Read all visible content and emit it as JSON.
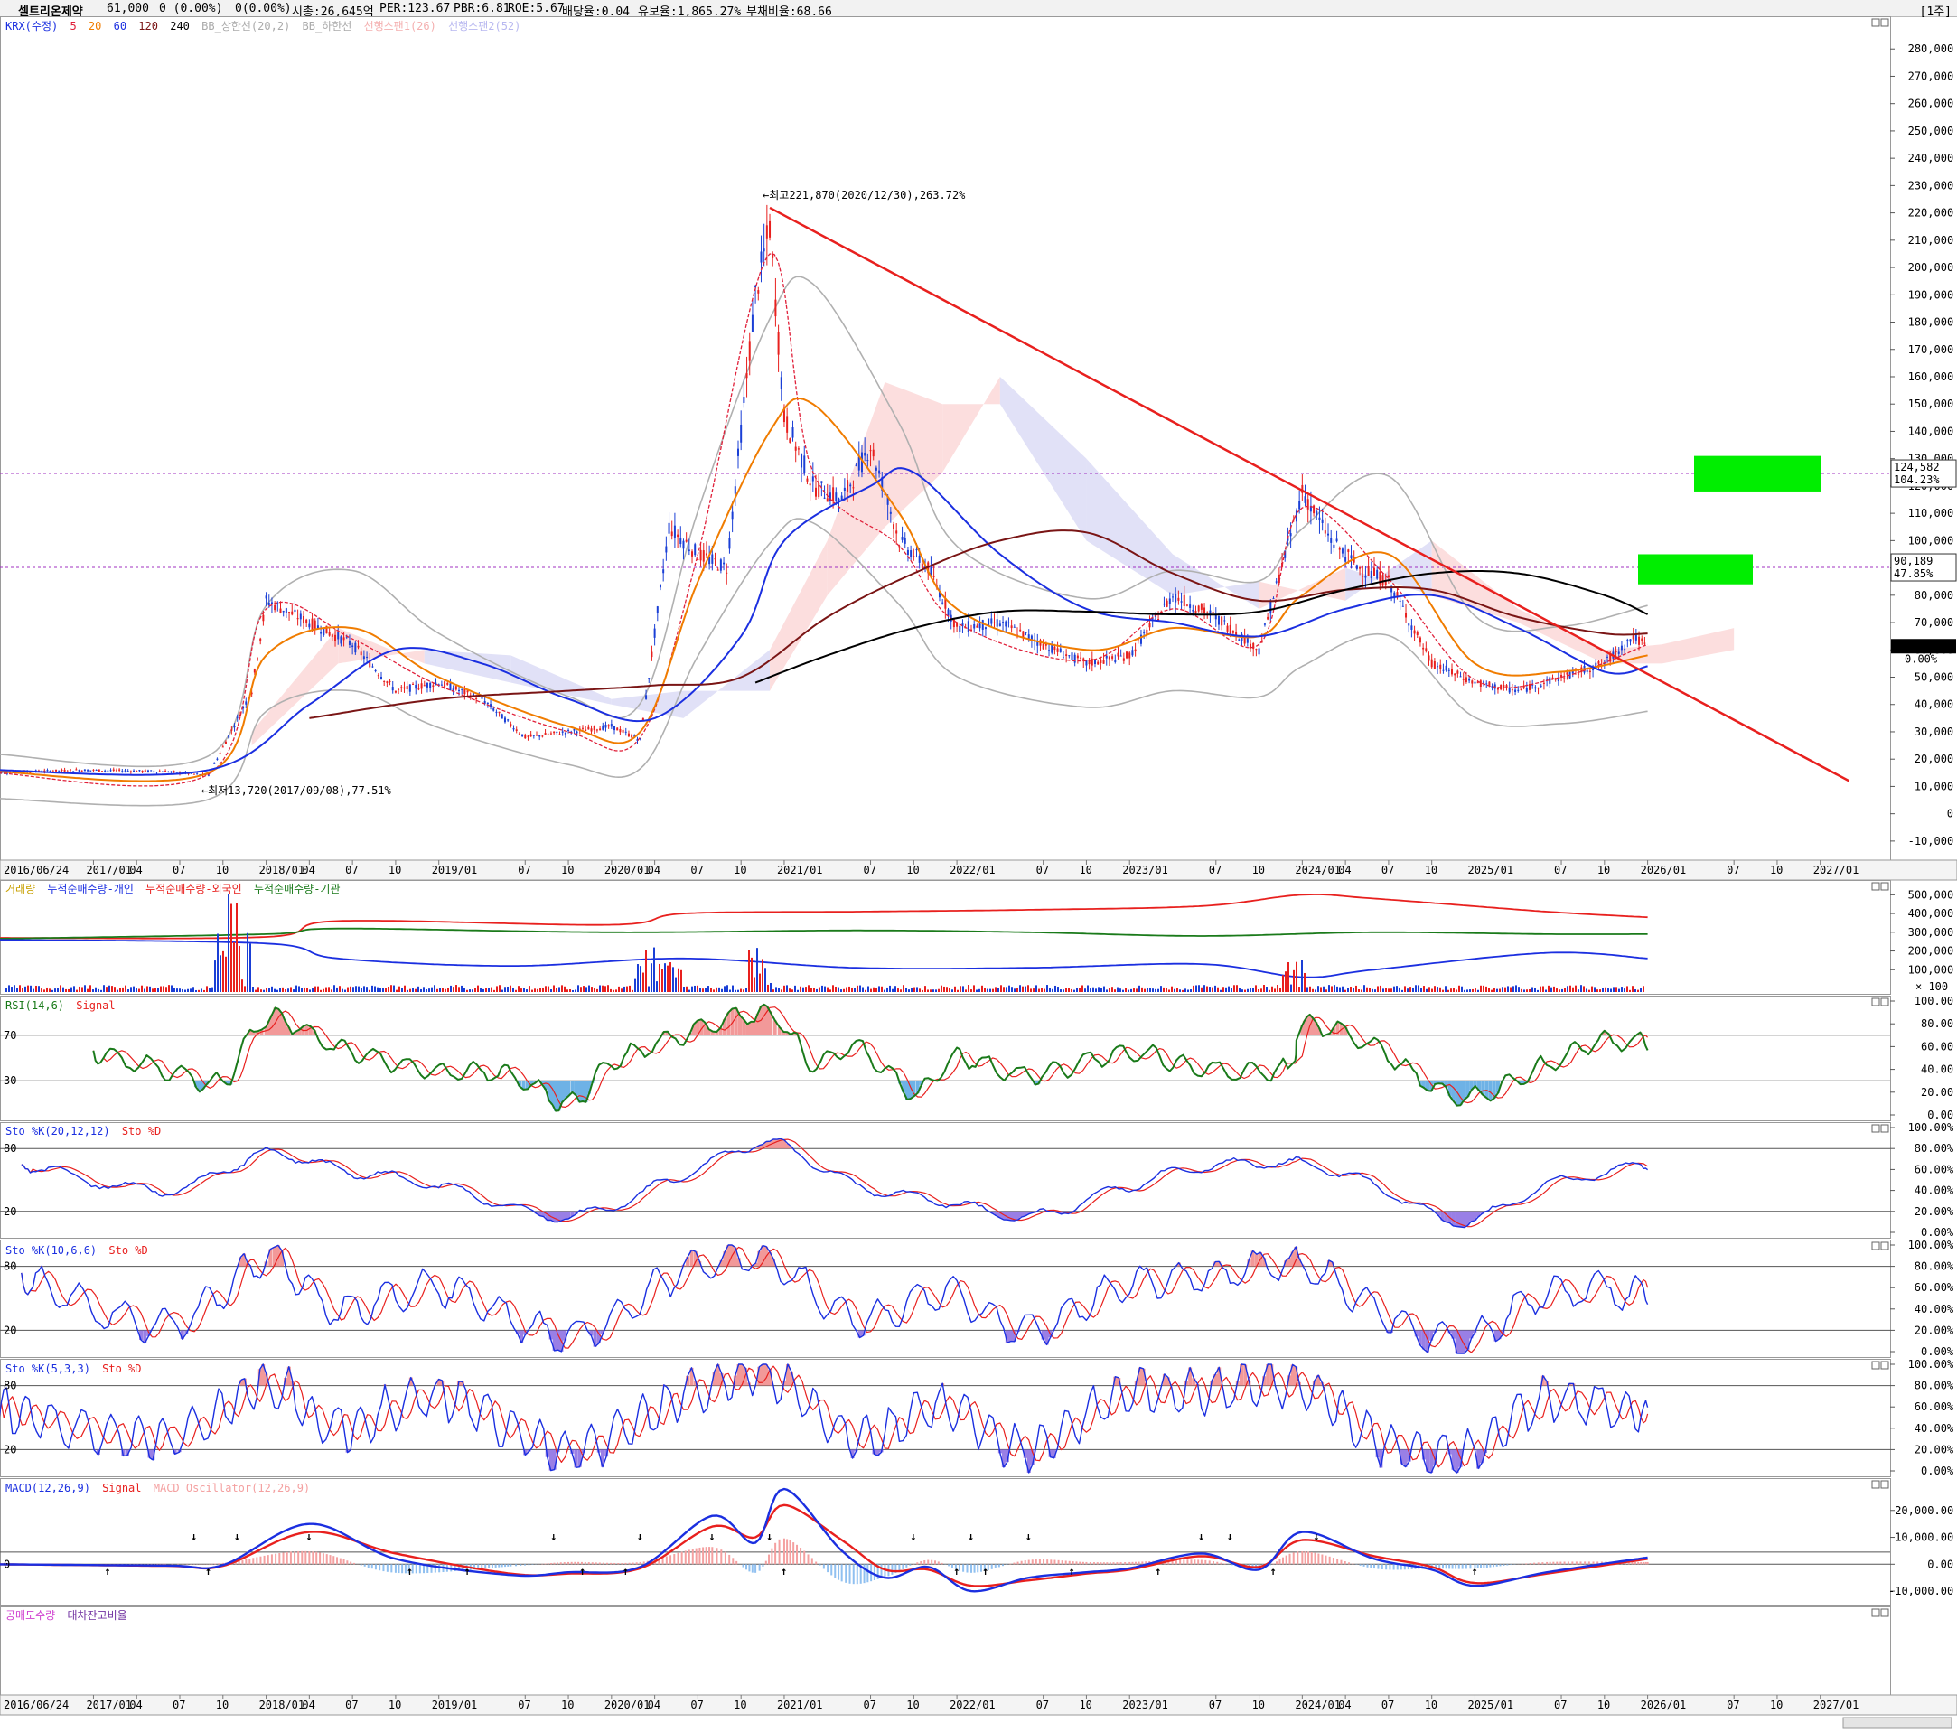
{
  "header": {
    "stock_name": "셀트리온제약",
    "price": "61,000",
    "change": "0 (0.00%)",
    "volume_change": "0(0.00%)",
    "market_cap": "시총:26,645억",
    "per": "PER:123.67",
    "pbr": "PBR:6.81",
    "roe": "ROE:5.67",
    "dividend": "배당율:0.04",
    "float_ratio": "유보율:1,865.27%",
    "debt_ratio": "부채비율:68.66",
    "period": "[1주]"
  },
  "colors": {
    "price_up": "#e8201e",
    "price_down": "#1a3fd6",
    "ma5": "#e0203a",
    "ma20": "#f07c00",
    "ma60": "#1b2fe0",
    "ma120": "#7a1515",
    "ma240": "#000000",
    "bollinger": "#b0b0b0",
    "trendline": "#e8201e",
    "target_box": "#00ee00",
    "rsi": "#1a7a1a",
    "sto_k": "#1b2fe0",
    "sto_d": "#e8201e",
    "cum_individual": "#1b2fe0",
    "cum_foreign": "#e8201e",
    "cum_institution": "#1a7a1a",
    "macd": "#1b2fe0",
    "macd_signal": "#e8201e",
    "macd_osc_pos": "#f4a0a0",
    "macd_osc_neg": "#90c0f0"
  },
  "legends": {
    "price": {
      "p1": "KRX(수정)",
      "p2": "5",
      "p3": "20",
      "p4": "60",
      "p5": "120",
      "p6": "240",
      "p7": "BB_상한선(20,2)",
      "p8": "BB_하한선",
      "p9": "선행스팬1(26)",
      "p10": "선행스팬2(52)"
    },
    "volume": {
      "v1": "거래량",
      "v2": "누적순매수량-개인",
      "v3": "누적순매수량-외국인",
      "v4": "누적순매수량-기관"
    },
    "rsi": {
      "r1": "RSI(14,6)",
      "r2": "Signal"
    },
    "sto1": {
      "k": "Sto %K(20,12,12)",
      "d": "Sto %D"
    },
    "sto2": {
      "k": "Sto %K(10,6,6)",
      "d": "Sto %D"
    },
    "sto3": {
      "k": "Sto %K(5,3,3)",
      "d": "Sto %D"
    },
    "macd": {
      "m1": "MACD(12,26,9)",
      "m2": "Signal",
      "m3": "MACD Oscillator(12,26,9)"
    },
    "short": {
      "s1": "공매도수량",
      "s2": "대차잔고비율"
    }
  },
  "annotations": {
    "high": "최고221,870(2020/12/30),263.72%",
    "low": "최저13,720(2017/09/08),77.51%",
    "level1_price": "124,582",
    "level1_pct": "104.23%",
    "level2_price": "90,189",
    "level2_pct": "47.85%",
    "current_price": "61,000",
    "current_pct": "0.00%",
    "rsi_upper": "70",
    "rsi_lower": "30",
    "sto_upper": "80",
    "sto_lower": "20",
    "macd_zero": "0",
    "volume_unit": "× 100"
  },
  "x_axis_labels": [
    "2016/06/24",
    "2017/01",
    "04",
    "07",
    "10",
    "2018/01",
    "04",
    "07",
    "10",
    "2019/01",
    "07",
    "10",
    "2020/01",
    "04",
    "07",
    "10",
    "2021/01",
    "07",
    "10",
    "2022/01",
    "07",
    "10",
    "2023/01",
    "07",
    "10",
    "2024/01",
    "04",
    "07",
    "10",
    "2025/01",
    "07",
    "10",
    "2026/01",
    "07",
    "10",
    "2027/01"
  ],
  "chart_data": [
    {
      "type": "candlestick",
      "title": "셀트리온제약 주간",
      "ylim": [
        -15000,
        290000
      ],
      "yticks": [
        "280,000",
        "270,000",
        "260,000",
        "250,000",
        "240,000",
        "230,000",
        "220,000",
        "210,000",
        "200,000",
        "190,000",
        "180,000",
        "170,000",
        "160,000",
        "150,000",
        "140,000",
        "130,000",
        "120,000",
        "110,000",
        "100,000",
        "90,000",
        "80,000",
        "70,000",
        "60,000",
        "50,000",
        "40,000",
        "30,000",
        "20,000",
        "10,000",
        "0",
        "-10,000"
      ],
      "x_start": "2016/06",
      "x_end": "2027/03",
      "series": [
        {
          "name": "KRX(수정)",
          "x": [
            "2016/06",
            "2016/12",
            "2017/06",
            "2017/09",
            "2017/12",
            "2018/01",
            "2018/04",
            "2018/07",
            "2018/10",
            "2019/01",
            "2019/04",
            "2019/07",
            "2019/10",
            "2020/01",
            "2020/03",
            "2020/05",
            "2020/07",
            "2020/09",
            "2020/11",
            "2020/12",
            "2021/01",
            "2021/03",
            "2021/05",
            "2021/07",
            "2021/09",
            "2021/11",
            "2022/01",
            "2022/04",
            "2022/07",
            "2022/10",
            "2023/01",
            "2023/04",
            "2023/07",
            "2023/10",
            "2024/01",
            "2024/03",
            "2024/05",
            "2024/07",
            "2024/10",
            "2025/01",
            "2025/04",
            "2025/07",
            "2025/10",
            "2025/12",
            "2026/01"
          ],
          "values": [
            15000,
            16000,
            15500,
            14000,
            45000,
            78000,
            70000,
            62000,
            45000,
            48000,
            42000,
            28000,
            30000,
            32000,
            27000,
            105000,
            95000,
            90000,
            190000,
            215000,
            145000,
            120000,
            115000,
            135000,
            100000,
            90000,
            68000,
            70000,
            62000,
            55000,
            58000,
            80000,
            72000,
            60000,
            118000,
            100000,
            90000,
            85000,
            55000,
            48000,
            45000,
            50000,
            55000,
            65000,
            61000
          ]
        },
        {
          "name": "5",
          "x": [
            "2016/06",
            "2017/09",
            "2018/01",
            "2018/07",
            "2019/01",
            "2019/10",
            "2020/03",
            "2020/07",
            "2020/12",
            "2021/03",
            "2021/09",
            "2022/01",
            "2022/10",
            "2023/04",
            "2023/10",
            "2024/01",
            "2024/07",
            "2025/01",
            "2025/07",
            "2026/01"
          ],
          "values": [
            15000,
            14500,
            75000,
            64000,
            47000,
            30000,
            28000,
            95000,
            205000,
            125000,
            98000,
            70000,
            56000,
            75000,
            62000,
            112000,
            86000,
            49000,
            50000,
            62000
          ]
        },
        {
          "name": "20",
          "x": [
            "2016/06",
            "2017/09",
            "2018/01",
            "2018/07",
            "2019/01",
            "2019/10",
            "2020/03",
            "2020/07",
            "2020/12",
            "2021/03",
            "2021/09",
            "2022/01",
            "2022/10",
            "2023/04",
            "2023/10",
            "2024/01",
            "2024/07",
            "2025/01",
            "2025/07",
            "2026/01"
          ],
          "values": [
            15500,
            15000,
            58000,
            68000,
            50000,
            32000,
            30000,
            85000,
            140000,
            150000,
            110000,
            75000,
            60000,
            68000,
            65000,
            80000,
            95000,
            55000,
            52000,
            58000
          ]
        },
        {
          "name": "60",
          "x": [
            "2016/06",
            "2017/09",
            "2018/04",
            "2018/10",
            "2019/04",
            "2019/10",
            "2020/04",
            "2020/10",
            "2021/01",
            "2021/07",
            "2021/10",
            "2022/04",
            "2022/10",
            "2023/04",
            "2023/10",
            "2024/04",
            "2024/10",
            "2025/04",
            "2025/10",
            "2026/01"
          ],
          "values": [
            16000,
            16000,
            40000,
            60000,
            55000,
            42000,
            35000,
            65000,
            100000,
            120000,
            125000,
            95000,
            75000,
            70000,
            65000,
            75000,
            80000,
            68000,
            52000,
            54000
          ]
        },
        {
          "name": "120",
          "x": [
            "2018/04",
            "2019/01",
            "2019/10",
            "2020/04",
            "2020/10",
            "2021/04",
            "2021/10",
            "2022/04",
            "2022/10",
            "2023/04",
            "2023/10",
            "2024/04",
            "2024/10",
            "2025/04",
            "2025/10",
            "2026/01"
          ],
          "values": [
            35000,
            42000,
            45000,
            47000,
            50000,
            72000,
            88000,
            100000,
            103000,
            88000,
            78000,
            82000,
            82000,
            72000,
            66000,
            66000
          ]
        },
        {
          "name": "240",
          "x": [
            "2020/11",
            "2021/04",
            "2021/10",
            "2022/04",
            "2022/10",
            "2023/04",
            "2023/10",
            "2024/04",
            "2024/10",
            "2025/04",
            "2025/10",
            "2026/01"
          ],
          "values": [
            48000,
            58000,
            68000,
            74000,
            74000,
            73000,
            74000,
            82000,
            88000,
            88000,
            80000,
            73000
          ]
        }
      ],
      "annotations_data": {
        "high_value": 221870,
        "high_date": "2020/12/30",
        "low_value": 13720,
        "low_date": "2017/09/08",
        "level1": 124582,
        "level2": 90189,
        "trend_start": 221870,
        "trend_start_date": "2020/12",
        "trend_end": 12000,
        "trend_end_date": "2027/03"
      }
    },
    {
      "type": "line",
      "ylim": [
        0,
        550000
      ],
      "yticks": [
        "500,000",
        "400,000",
        "300,000",
        "200,000",
        "100,000"
      ],
      "series": [
        {
          "name": "누적순매수량-외국인",
          "x": [
            "2016/06",
            "2018/01",
            "2018/06",
            "2020/01",
            "2020/06",
            "2021/06",
            "2022/06",
            "2023/06",
            "2024/01",
            "2024/06",
            "2025/06",
            "2026/01"
          ],
          "values": [
            270000,
            275000,
            360000,
            340000,
            400000,
            410000,
            420000,
            440000,
            500000,
            480000,
            410000,
            380000
          ]
        },
        {
          "name": "누적순매수량-기관",
          "x": [
            "2016/06",
            "2018/01",
            "2018/06",
            "2020/01",
            "2021/06",
            "2022/06",
            "2023/06",
            "2024/06",
            "2025/06",
            "2026/01"
          ],
          "values": [
            265000,
            290000,
            320000,
            300000,
            310000,
            300000,
            280000,
            300000,
            290000,
            290000
          ]
        },
        {
          "name": "누적순매수량-개인",
          "x": [
            "2016/06",
            "2018/01",
            "2018/06",
            "2019/06",
            "2020/06",
            "2021/06",
            "2022/06",
            "2023/06",
            "2024/01",
            "2024/06",
            "2025/06",
            "2026/01"
          ],
          "values": [
            260000,
            240000,
            160000,
            120000,
            160000,
            110000,
            110000,
            130000,
            60000,
            100000,
            190000,
            160000
          ]
        }
      ]
    },
    {
      "type": "line",
      "ylim": [
        0,
        100
      ],
      "yticks": [
        "100.00",
        "80.00",
        "60.00",
        "40.00",
        "20.00",
        "0.00"
      ],
      "series": [
        {
          "name": "RSI(14,6)",
          "x": [
            "2017/01",
            "2017/06",
            "2017/10",
            "2018/01",
            "2018/06",
            "2018/12",
            "2019/06",
            "2019/10",
            "2020/01",
            "2020/06",
            "2020/12",
            "2021/03",
            "2021/06",
            "2021/10",
            "2022/01",
            "2022/06",
            "2023/01",
            "2023/06",
            "2023/12",
            "2024/01",
            "2024/06",
            "2024/12",
            "2025/06",
            "2025/10",
            "2026/01"
          ],
          "values": [
            55,
            40,
            30,
            85,
            60,
            40,
            35,
            10,
            45,
            70,
            88,
            45,
            60,
            20,
            50,
            35,
            55,
            40,
            42,
            80,
            60,
            15,
            45,
            65,
            62
          ]
        }
      ]
    },
    {
      "type": "line",
      "ylim": [
        0,
        100
      ],
      "yticks": [
        "100.00%",
        "80.00%",
        "60.00%",
        "40.00%",
        "20.00%",
        "0.00%"
      ],
      "series": [
        {
          "name": "Sto %K(20,12,12)",
          "x": [
            "2016/08",
            "2017/06",
            "2018/01",
            "2018/06",
            "2019/01",
            "2019/10",
            "2020/06",
            "2020/12",
            "2021/06",
            "2021/12",
            "2022/06",
            "2022/12",
            "2023/06",
            "2024/01",
            "2024/06",
            "2024/12",
            "2025/06",
            "2026/01"
          ],
          "values": [
            65,
            40,
            75,
            60,
            45,
            15,
            55,
            85,
            45,
            30,
            15,
            40,
            62,
            65,
            45,
            10,
            45,
            65
          ]
        }
      ]
    },
    {
      "type": "line",
      "ylim": [
        0,
        100
      ],
      "yticks": [
        "100.00%",
        "80.00%",
        "60.00%",
        "40.00%",
        "20.00%",
        "0.00%"
      ],
      "series": [
        {
          "name": "Sto %K(10,6,6)",
          "x": [
            "2016/08",
            "2017/06",
            "2018/01",
            "2018/06",
            "2019/01",
            "2019/10",
            "2020/06",
            "2020/12",
            "2021/06",
            "2021/12",
            "2022/06",
            "2022/12",
            "2023/06",
            "2024/01",
            "2024/06",
            "2024/12",
            "2025/06",
            "2026/01"
          ],
          "values": [
            70,
            25,
            85,
            40,
            60,
            15,
            75,
            85,
            30,
            55,
            20,
            60,
            70,
            80,
            40,
            10,
            55,
            55
          ]
        }
      ]
    },
    {
      "type": "line",
      "ylim": [
        0,
        100
      ],
      "yticks": [
        "100.00%",
        "80.00%",
        "60.00%",
        "40.00%",
        "20.00%",
        "0.00%"
      ],
      "series": [
        {
          "name": "Sto %K(5,3,3)",
          "x": [
            "2016/06",
            "2017/06",
            "2018/01",
            "2018/06",
            "2019/01",
            "2019/10",
            "2020/06",
            "2020/12",
            "2021/06",
            "2021/12",
            "2022/06",
            "2022/12",
            "2023/06",
            "2024/01",
            "2024/06",
            "2024/12",
            "2025/06",
            "2026/01"
          ],
          "values": [
            60,
            30,
            80,
            40,
            70,
            20,
            70,
            90,
            30,
            60,
            20,
            70,
            75,
            80,
            30,
            15,
            65,
            50
          ]
        }
      ]
    },
    {
      "type": "line",
      "ylim": [
        -13000,
        30000
      ],
      "yticks": [
        "20,000.00",
        "10,000.00",
        "0.00",
        "-10,000.00"
      ],
      "series": [
        {
          "name": "MACD(12,26,9)",
          "x": [
            "2016/06",
            "2017/06",
            "2017/10",
            "2018/04",
            "2018/10",
            "2019/06",
            "2019/10",
            "2020/03",
            "2020/08",
            "2020/11",
            "2021/01",
            "2021/05",
            "2021/08",
            "2021/11",
            "2022/02",
            "2022/06",
            "2022/10",
            "2023/01",
            "2023/06",
            "2023/10",
            "2024/01",
            "2024/06",
            "2024/10",
            "2025/01",
            "2025/06",
            "2026/01"
          ],
          "values": [
            0,
            -500,
            -300,
            15000,
            2000,
            -4000,
            -3000,
            -1000,
            18000,
            8000,
            28000,
            5000,
            -5000,
            -1000,
            -10000,
            -5000,
            -3000,
            -1500,
            4000,
            -2000,
            12000,
            2000,
            -2000,
            -8000,
            -3000,
            2500
          ]
        },
        {
          "name": "Signal",
          "x": [
            "2016/06",
            "2017/06",
            "2017/10",
            "2018/04",
            "2018/10",
            "2019/06",
            "2019/10",
            "2020/03",
            "2020/08",
            "2020/11",
            "2021/01",
            "2021/05",
            "2021/08",
            "2021/11",
            "2022/02",
            "2022/06",
            "2022/10",
            "2023/01",
            "2023/06",
            "2023/10",
            "2024/01",
            "2024/06",
            "2024/10",
            "2025/01",
            "2025/06",
            "2026/01"
          ],
          "values": [
            0,
            -600,
            -600,
            12000,
            4000,
            -3500,
            -3500,
            -1500,
            14000,
            10000,
            22000,
            9000,
            -2000,
            -2000,
            -8000,
            -6000,
            -3500,
            -2000,
            3000,
            -1000,
            9000,
            3000,
            -1000,
            -7000,
            -3500,
            2000
          ]
        }
      ]
    }
  ]
}
